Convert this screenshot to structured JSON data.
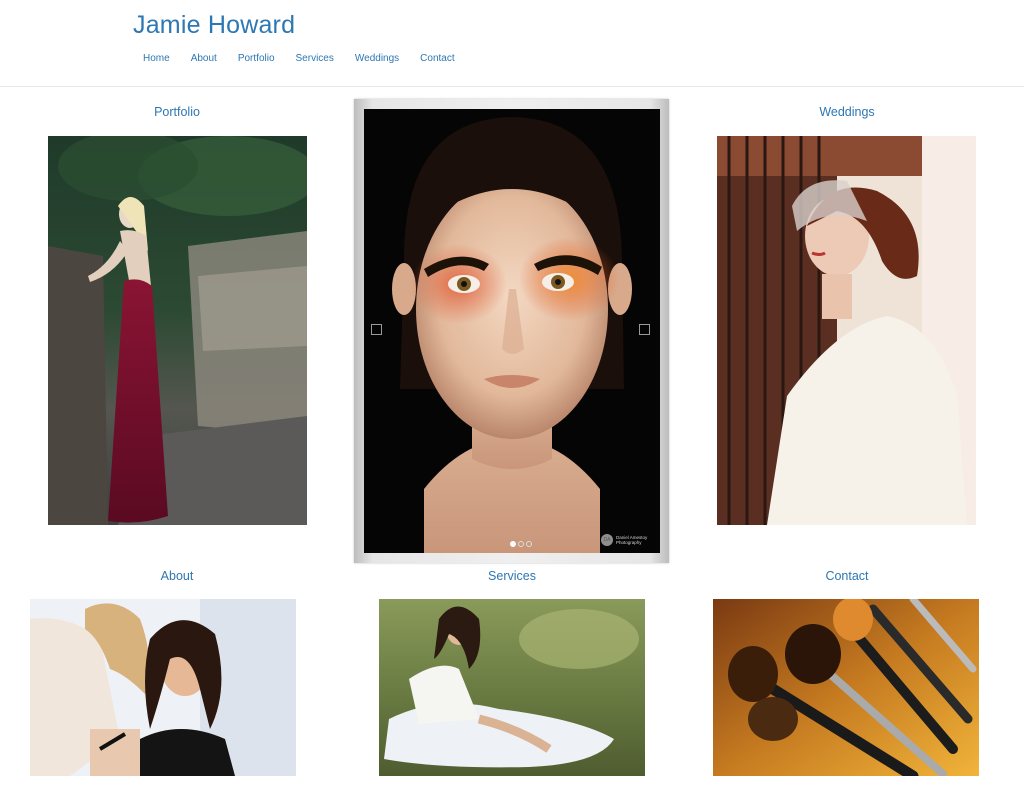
{
  "site": {
    "title": "Jamie Howard"
  },
  "nav": {
    "items": [
      {
        "label": "Home"
      },
      {
        "label": "About"
      },
      {
        "label": "Portfolio"
      },
      {
        "label": "Services"
      },
      {
        "label": "Weddings"
      },
      {
        "label": "Contact"
      }
    ]
  },
  "sections": {
    "portfolio": {
      "title": "Portfolio"
    },
    "weddings": {
      "title": "Weddings"
    },
    "about": {
      "title": "About"
    },
    "services": {
      "title": "Services"
    },
    "contact": {
      "title": "Contact"
    }
  },
  "slider": {
    "active_index": 0,
    "slide_count": 3,
    "watermark_logo": "DA",
    "watermark_text": "Daniel Amestoy Photography"
  },
  "colors": {
    "accent": "#2d77b3",
    "background": "#ffffff"
  }
}
